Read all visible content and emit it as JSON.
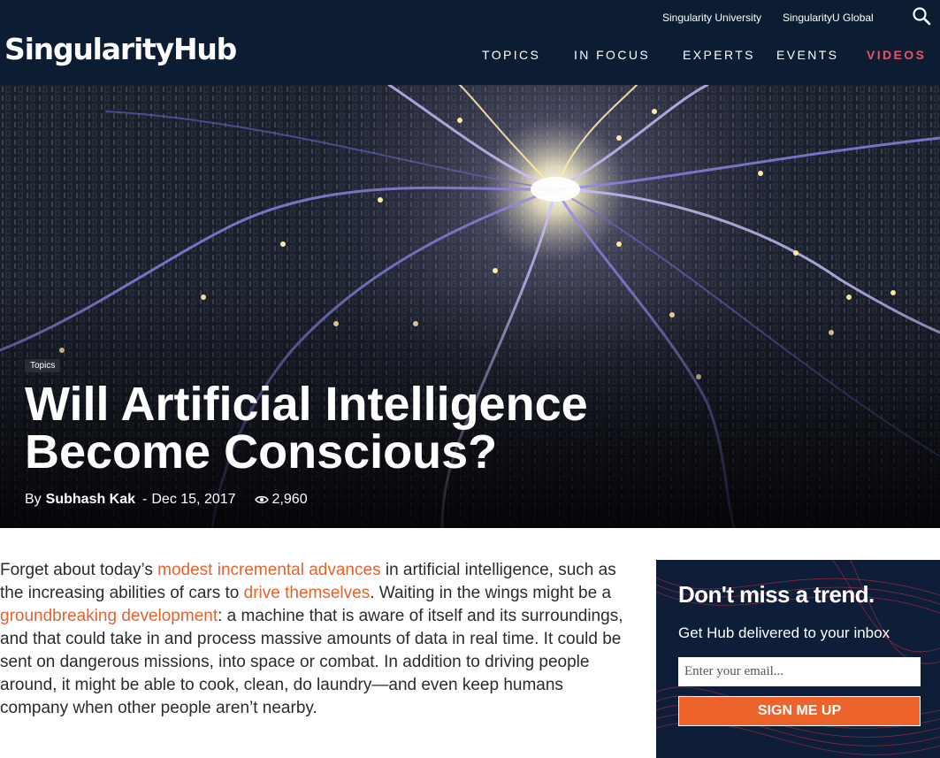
{
  "header": {
    "logo": "SingularityHub",
    "util_links": [
      "Singularity University",
      "SingularityU Global"
    ],
    "nav": [
      "TOPICS",
      "IN FOCUS",
      "EXPERTS",
      "EVENTS",
      "VIDEOS"
    ],
    "active_nav": "VIDEOS",
    "icon": "search-icon"
  },
  "hero": {
    "tag": "Topics",
    "title_line1": "Will Artificial Intelligence",
    "title_line2": "Become Conscious?",
    "by": "By",
    "author": "Subhash Kak",
    "date_sep": "-",
    "date": "Dec 15, 2017",
    "views": "2,960",
    "views_icon": "eye-icon"
  },
  "article": {
    "p1_t1": "Forget about today’s ",
    "p1_link1": "modest incremental advances",
    "p1_t2": " in artificial intelligence, such as the increasing abilities of cars to ",
    "p1_link2": "drive themselves",
    "p1_t3": ". Waiting in the wings might be a ",
    "p1_link3": "groundbreaking development",
    "p1_t4": ": a machine that is aware of itself and its surroundings, and that could take in and process massive amounts of data in real time. It could be sent on dangerous missions, into space or combat. In addition to driving people around, it might be able to cook, clean, do laundry—and even keep humans company when other people aren’t nearby."
  },
  "newsletter": {
    "title": "Don't miss a trend.",
    "subtitle": "Get Hub delivered to your inbox",
    "email_placeholder": "Enter your email...",
    "button": "SIGN ME UP"
  },
  "colors": {
    "header_bg": "#0c1c33",
    "active_nav": "#e8526b",
    "link": "#e5632f",
    "cta": "#ec632c",
    "promo_bg": "#0f1e38"
  }
}
